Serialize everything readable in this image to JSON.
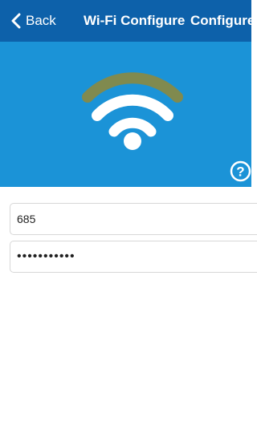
{
  "navbar": {
    "back_label": "Back",
    "title": "Wi-Fi Configure",
    "action_label": "Configure"
  },
  "hero": {
    "icon": "wifi-icon",
    "signal_strength": "3 of 4 arcs white, outer arc olive",
    "help_icon": "question-mark-icon"
  },
  "form": {
    "ssid_value": "685",
    "password_value": "•••••••••••"
  },
  "colors": {
    "navbar": "#0d61aa",
    "hero": "#1b93d7",
    "wifi_active": "#ffffff",
    "wifi_outer_arc": "#808a4f"
  }
}
